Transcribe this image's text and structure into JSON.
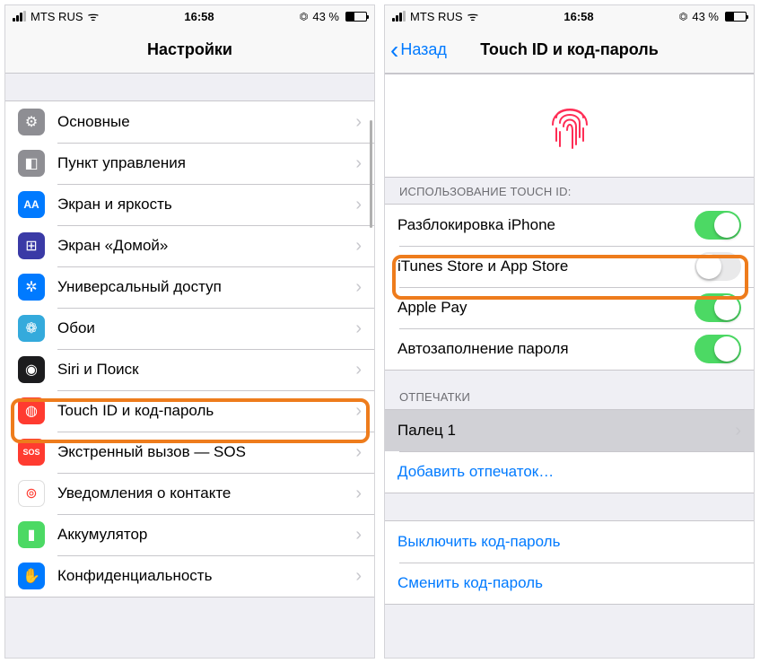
{
  "status": {
    "carrier": "MTS RUS",
    "time": "16:58",
    "battery_pct": "43 %",
    "wifi_glyph": "ᯤ",
    "lock_glyph": "⏣"
  },
  "left": {
    "title": "Настройки",
    "items": [
      {
        "label": "Основные",
        "icon_bg": "#8e8e93",
        "icon_glyph": "⚙"
      },
      {
        "label": "Пункт управления",
        "icon_bg": "#8e8e93",
        "icon_glyph": "◧"
      },
      {
        "label": "Экран и яркость",
        "icon_bg": "#007aff",
        "icon_glyph": "AA"
      },
      {
        "label": "Экран «Домой»",
        "icon_bg": "#3a3aa6",
        "icon_glyph": "⊞"
      },
      {
        "label": "Универсальный доступ",
        "icon_bg": "#007aff",
        "icon_glyph": "✲"
      },
      {
        "label": "Обои",
        "icon_bg": "#34aadc",
        "icon_glyph": "❁"
      },
      {
        "label": "Siri и Поиск",
        "icon_bg": "#1c1c1e",
        "icon_glyph": "◉"
      },
      {
        "label": "Touch ID и код-пароль",
        "icon_bg": "#ff3b30",
        "icon_glyph": "◍"
      },
      {
        "label": "Экстренный вызов — SOS",
        "icon_bg": "#ff3b30",
        "icon_glyph": "SOS"
      },
      {
        "label": "Уведомления о контакте",
        "icon_bg": "#ffffff",
        "icon_glyph": "⊚",
        "icon_fg": "#ff3b30",
        "border": true
      },
      {
        "label": "Аккумулятор",
        "icon_bg": "#4cd964",
        "icon_glyph": "▮"
      },
      {
        "label": "Конфиденциальность",
        "icon_bg": "#007aff",
        "icon_glyph": "✋"
      }
    ]
  },
  "right": {
    "back": "Назад",
    "title": "Touch ID и код-пароль",
    "usage_header": "ИСПОЛЬЗОВАНИЕ TOUCH ID:",
    "toggles": [
      {
        "label": "Разблокировка iPhone",
        "on": true
      },
      {
        "label": "iTunes Store и App Store",
        "on": false
      },
      {
        "label": "Apple Pay",
        "on": true
      },
      {
        "label": "Автозаполнение пароля",
        "on": true
      }
    ],
    "prints_header": "ОТПЕЧАТКИ",
    "finger": "Палец 1",
    "add_print": "Добавить отпечаток…",
    "disable_link": "Выключить код-пароль",
    "change_link": "Сменить код-пароль"
  }
}
